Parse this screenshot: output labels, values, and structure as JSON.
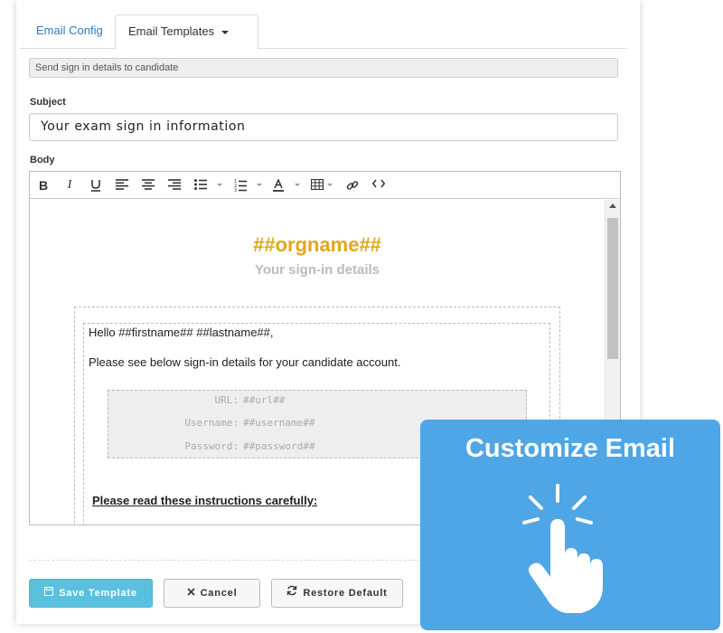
{
  "tabs": [
    {
      "label": "Email Config"
    },
    {
      "label": "Email Templates"
    }
  ],
  "template_select": {
    "value": "Send sign in details to candidate"
  },
  "subject": {
    "label": "Subject",
    "value": "Your exam sign in information"
  },
  "body": {
    "label": "Body",
    "toolbar": [
      "bold",
      "italic",
      "underline",
      "align-left",
      "align-center",
      "align-right",
      "bullet-list",
      "numbered-list",
      "font-color",
      "table",
      "link",
      "code-view"
    ],
    "org_placeholder": "##orgname##",
    "signin_title": "Your sign-in details",
    "greeting": "Hello ##firstname## ##lastname##,",
    "intro": "Please see below sign-in details for your candidate account.",
    "credentials": [
      {
        "label": "URL:",
        "value": "##url##"
      },
      {
        "label": "Username:",
        "value": "##username##"
      },
      {
        "label": "Password:",
        "value": "##password##"
      }
    ],
    "instructions_heading": "Please read these instructions carefully:"
  },
  "buttons": {
    "save": "Save Template",
    "cancel": "Cancel",
    "restore": "Restore Default"
  },
  "overlay": {
    "title": "Customize Email"
  },
  "colors": {
    "accent": "#337ab7",
    "org_gold": "#e0a81c",
    "save_button": "#5bc0de",
    "overlay_bg": "#4ea6e6"
  }
}
